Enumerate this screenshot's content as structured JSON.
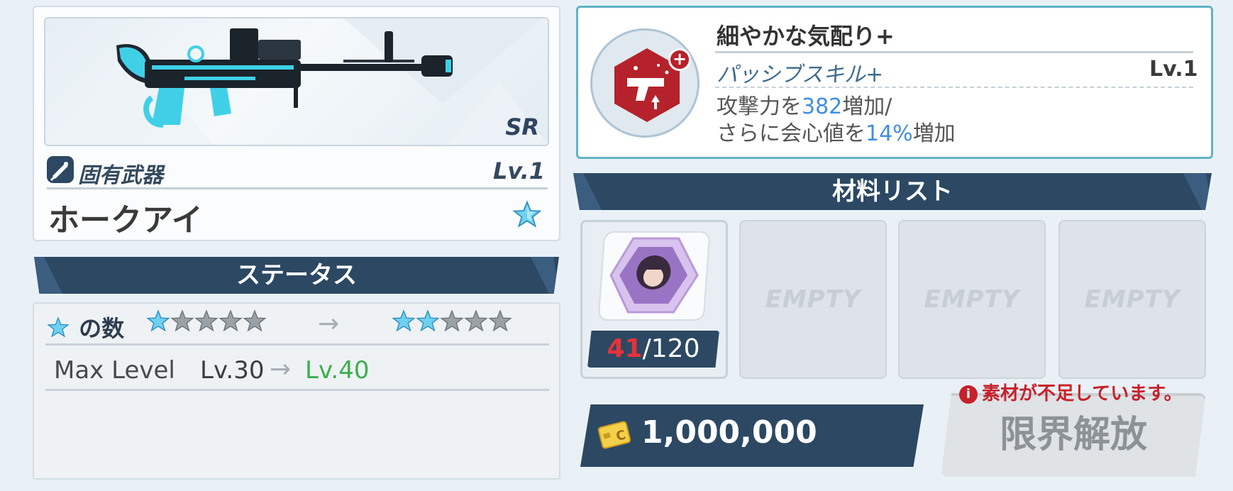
{
  "weapon": {
    "rarity": "SR",
    "type_label": "固有武器",
    "level": "Lv.1",
    "name": "ホークアイ"
  },
  "status": {
    "banner": "ステータス",
    "stars_label": "の数",
    "stars_before": 1,
    "stars_after": 2,
    "stars_max": 5,
    "arrow": "→",
    "max_level_label": "Max Level",
    "max_level_before": "Lv.30",
    "max_level_after": "Lv.40"
  },
  "skill": {
    "name": "細やかな気配り+",
    "type": "パッシブスキル+",
    "level": "Lv.1",
    "desc_line1_pre": "攻撃力を",
    "desc_line1_value": "382",
    "desc_line1_post": "増加/",
    "desc_line2_pre": "さらに会心値を",
    "desc_line2_value": "14%",
    "desc_line2_post": "増加",
    "icon": "gun-upgrade-icon"
  },
  "materials": {
    "banner": "材料リスト",
    "item_have": "41",
    "item_need": "/120",
    "empty_label": "EMPTY"
  },
  "cost": {
    "value": "1,000,000"
  },
  "warning": {
    "icon": "i",
    "text": "素材が不足しています。"
  },
  "action": {
    "limit_break_label": "限界解放"
  },
  "colors": {
    "navy": "#2c4863",
    "accent_teal": "#60b4c4",
    "highlight_blue": "#3f8fe0",
    "level_green": "#3cae4e",
    "warning_red": "#c7212b"
  }
}
